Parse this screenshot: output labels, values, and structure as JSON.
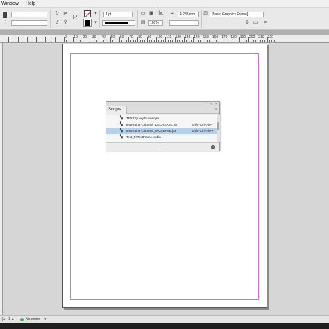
{
  "menu": {
    "items": [
      "Window",
      "Help"
    ]
  },
  "control": {
    "stroke_weight": "1 pt",
    "zoom": "100%",
    "width_value": "4.233 mm",
    "object_style": "[Basic Graphics Frame]",
    "fx_label": "fx."
  },
  "ruler": {
    "labels": [
      "0",
      "10",
      "20",
      "30",
      "40",
      "50",
      "60",
      "70",
      "80",
      "90",
      "100",
      "110",
      "120",
      "130",
      "140",
      "150",
      "160",
      "170",
      "180",
      "190",
      "200",
      "210",
      "220"
    ]
  },
  "scripts_panel": {
    "collapse_label": "«",
    "close_label": "×",
    "tab_label": "Scripts",
    "menu_label": "≡",
    "items": [
      {
        "name": "TEXT Query Runner.jsx",
        "shortcut": ""
      },
      {
        "name": "textFrame Columns_DECREASE.jsx",
        "shortcut": "Shift+Ctrl+Alt+-"
      },
      {
        "name": "textFrame Columns_INCREASE.jsx",
        "shortcut": "Shift+Ctrl+Alt++"
      },
      {
        "name": "Text_FitTextFrame.jsxbin",
        "shortcut": ""
      }
    ],
    "selected_index": 2,
    "info_label": "i"
  },
  "status": {
    "page": "1",
    "errors": "No errors"
  },
  "colors": {
    "margin_guide": "#d16fd8",
    "selection": "#b7d0ea",
    "no_errors": "#3bb34a"
  }
}
